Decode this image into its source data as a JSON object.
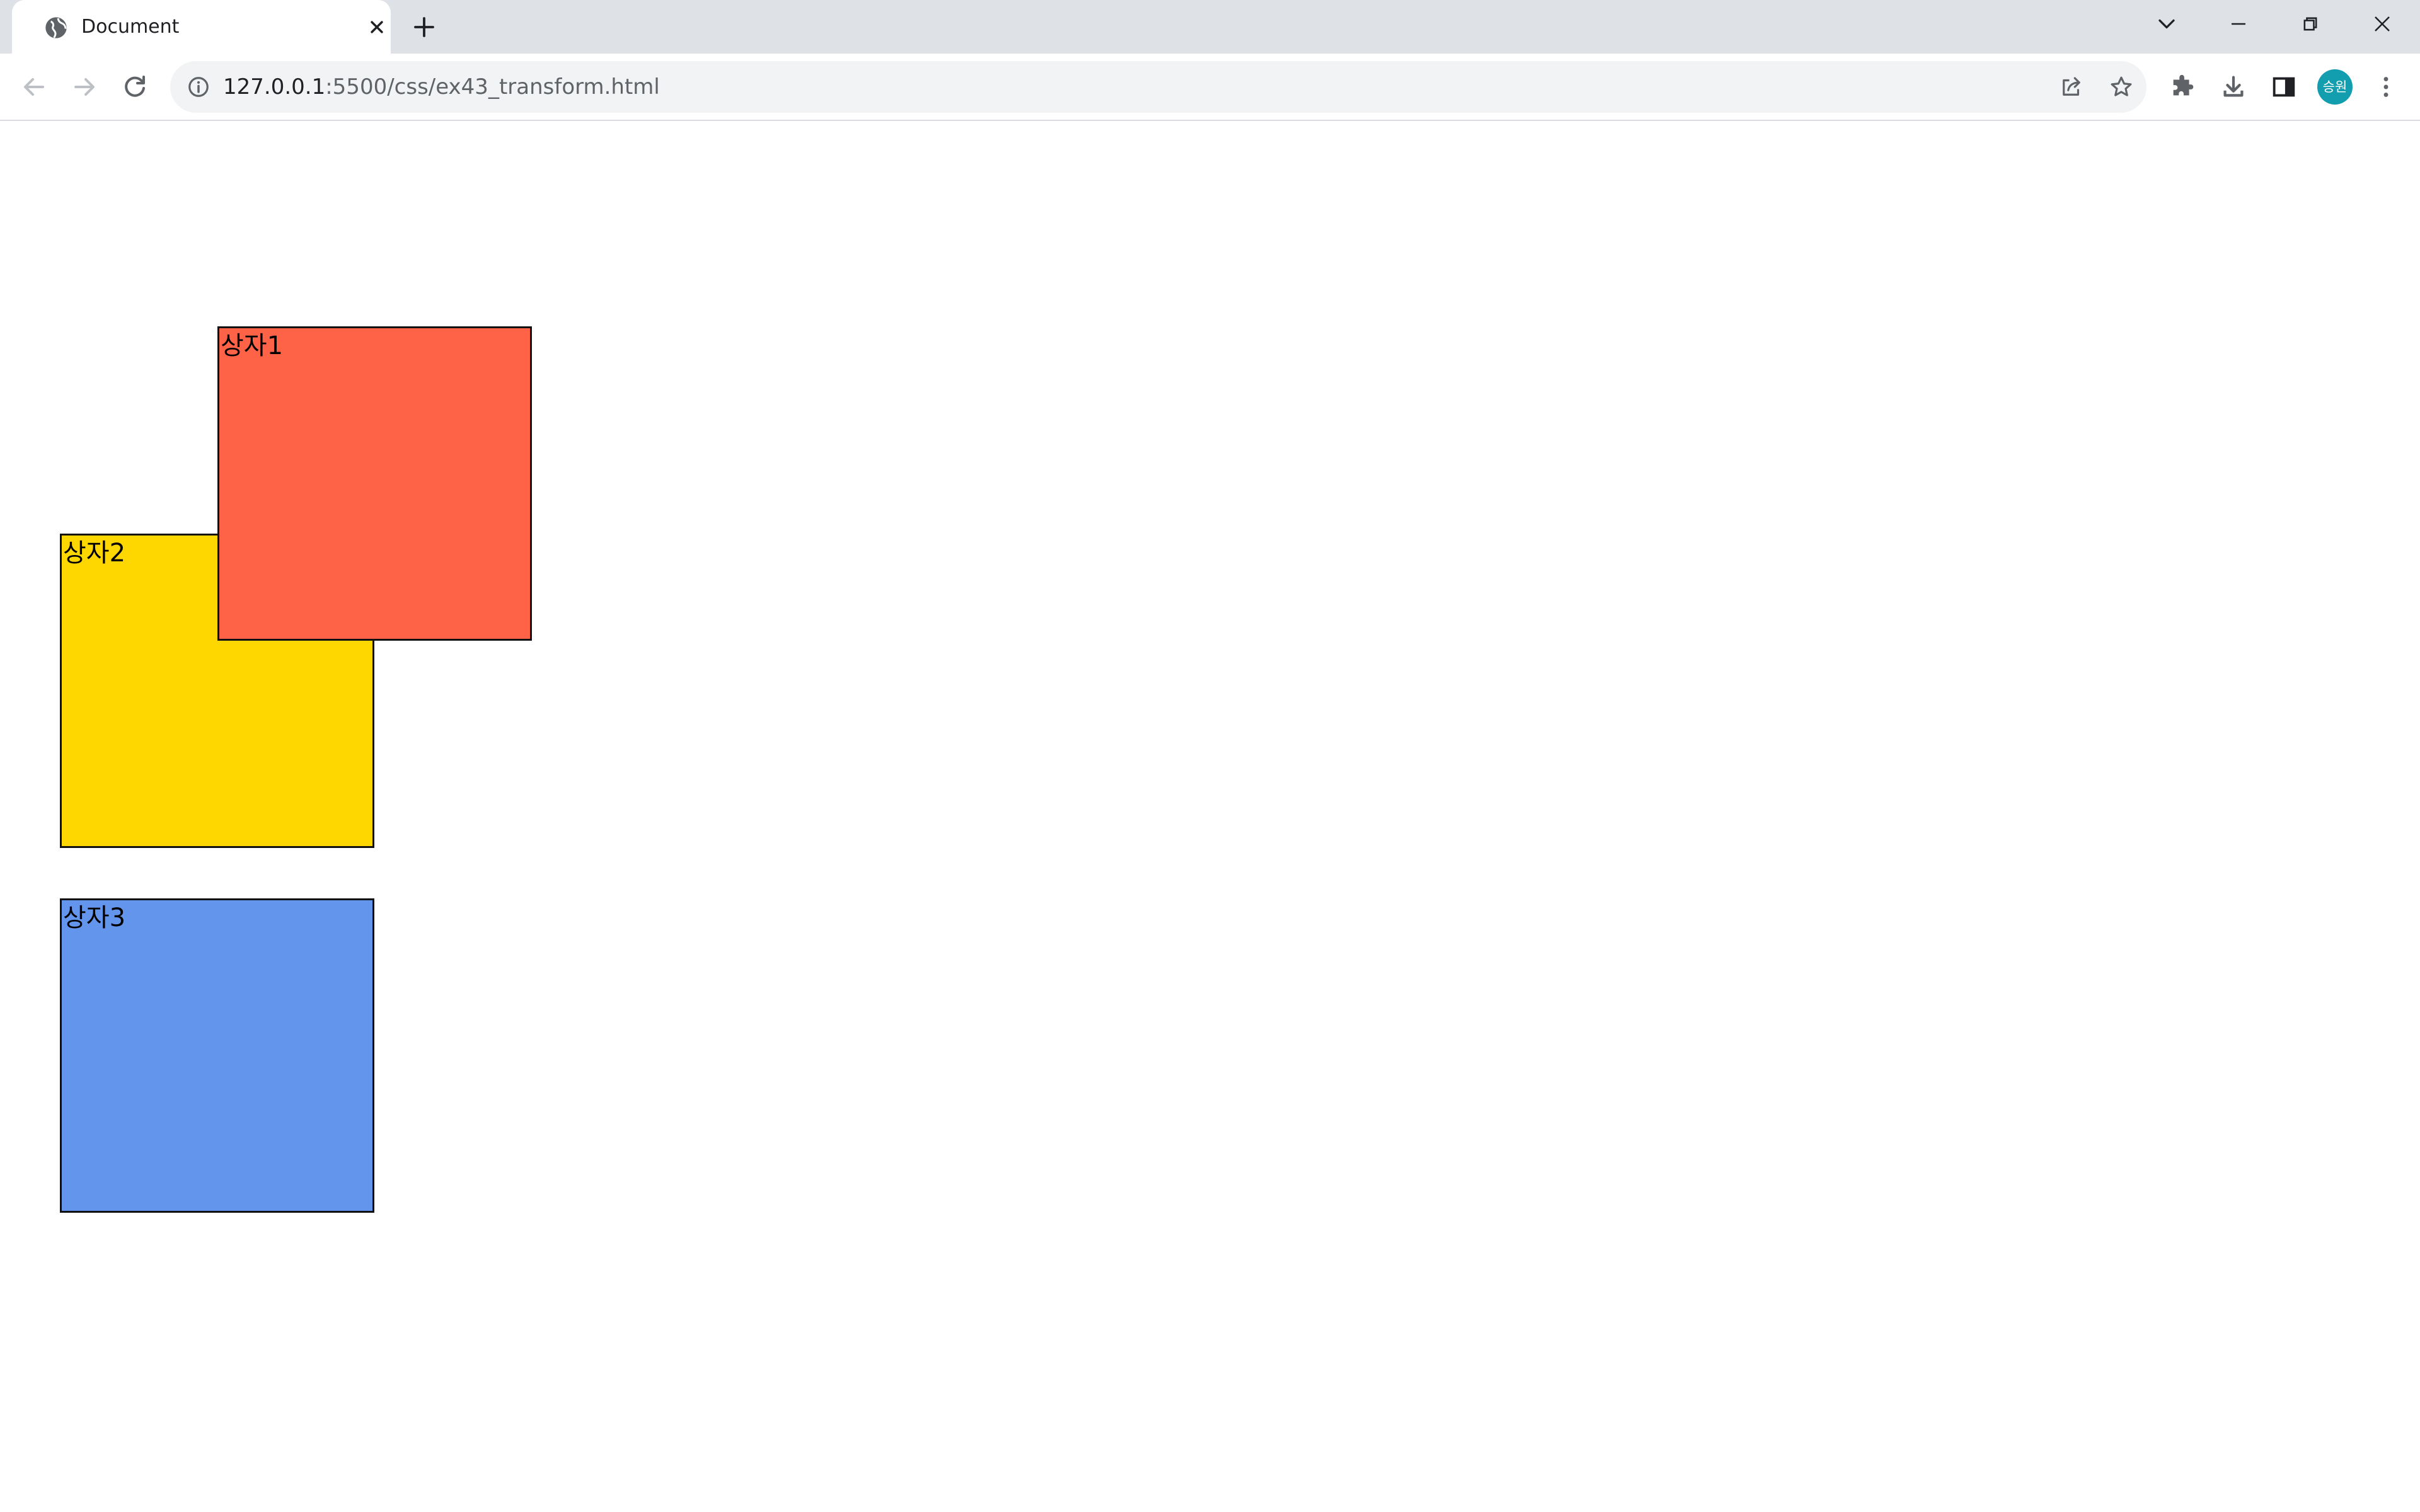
{
  "browser": {
    "tab": {
      "title": "Document",
      "favicon": "globe-icon",
      "close_icon": "close-icon"
    },
    "new_tab_icon": "plus-icon",
    "window_controls": [
      "tab-search-icon",
      "minimize-icon",
      "restore-icon",
      "close-icon"
    ],
    "address": {
      "host": "127.0.0.1",
      "rest": ":5500/css/ex43_transform.html"
    },
    "nav": [
      "back-icon",
      "forward-icon",
      "reload-icon"
    ],
    "omnibox_actions": [
      "share-icon",
      "bookmark-star-icon"
    ],
    "toolbar_icons": [
      "extensions-icon",
      "download-icon",
      "side-panel-icon",
      "more-menu-icon"
    ],
    "profile": {
      "initials": "승원",
      "color": "#129eaf"
    }
  },
  "page": {
    "boxes": [
      {
        "label": "상자1",
        "color": "#ff6347"
      },
      {
        "label": "상자2",
        "color": "#ffd700"
      },
      {
        "label": "상자3",
        "color": "#6495ed"
      }
    ]
  }
}
